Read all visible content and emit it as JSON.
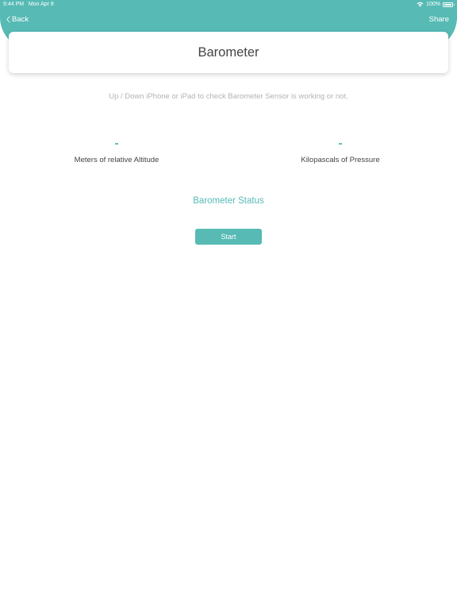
{
  "status_bar": {
    "time": "9:44 PM",
    "date": "Mon Apr 8",
    "battery": "100%",
    "icons": [
      "wifi-icon",
      "battery-icon"
    ]
  },
  "nav": {
    "back_label": "Back",
    "back_icon": "chevron-left-icon",
    "share_label": "Share"
  },
  "title": "Barometer",
  "instruction": "Up / Down iPhone or iPad  to check Barometer Sensor is working or not.",
  "metrics": [
    {
      "value": "-",
      "label": "Meters of relative Altitude"
    },
    {
      "value": "-",
      "label": "Kilopascals of Pressure"
    }
  ],
  "status_label": "Barometer Status",
  "start_button": "Start",
  "colors": {
    "accent": "#57bab5",
    "text_dark": "#444444",
    "text_muted": "#b3b3b3",
    "background": "#ffffff"
  }
}
